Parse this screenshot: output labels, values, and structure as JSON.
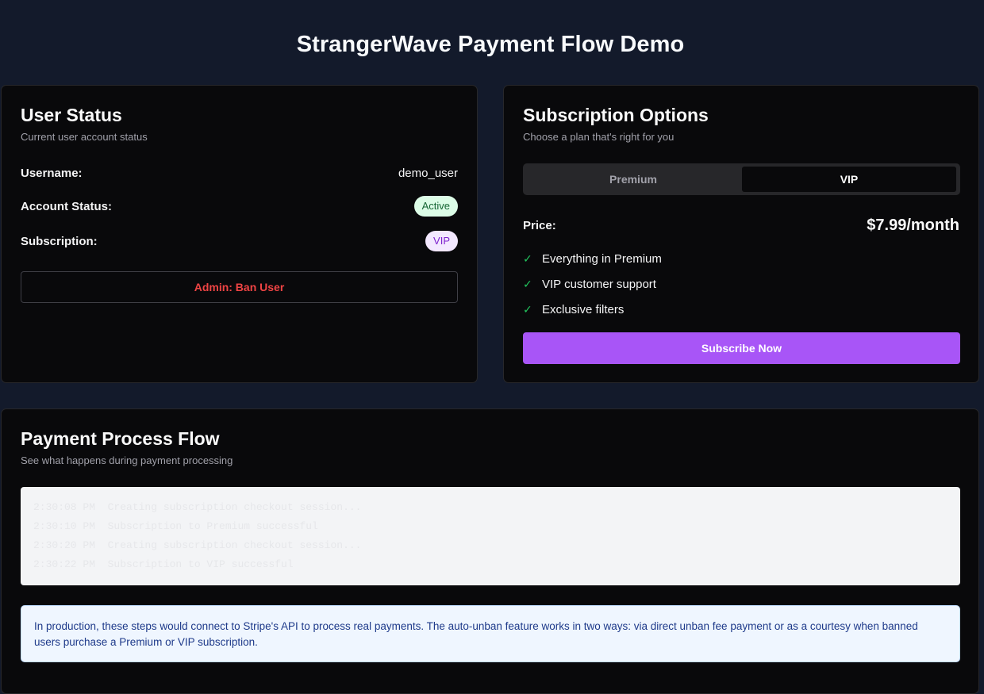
{
  "page": {
    "title": "StrangerWave Payment Flow Demo"
  },
  "user_status": {
    "title": "User Status",
    "subtitle": "Current user account status",
    "rows": [
      {
        "label": "Username:",
        "value": "demo_user"
      },
      {
        "label": "Account Status:",
        "value": "Active"
      },
      {
        "label": "Subscription:",
        "value": "VIP"
      }
    ],
    "ban_button": "Admin: Ban User"
  },
  "subscription": {
    "title": "Subscription Options",
    "subtitle": "Choose a plan that's right for you",
    "tabs": [
      {
        "label": "Premium",
        "selected": false
      },
      {
        "label": "VIP",
        "selected": true
      }
    ],
    "price_label": "Price:",
    "price_value": "$7.99/month",
    "features": [
      "Everything in Premium",
      "VIP customer support",
      "Exclusive filters"
    ],
    "subscribe_button": "Subscribe Now"
  },
  "payment_flow": {
    "title": "Payment Process Flow",
    "subtitle": "See what happens during payment processing",
    "log": [
      "2:30:08 PM  Creating subscription checkout session...",
      "2:30:10 PM  Subscription to Premium successful",
      "2:30:20 PM  Creating subscription checkout session...",
      "2:30:22 PM  Subscription to VIP successful"
    ],
    "info": "In production, these steps would connect to Stripe's API to process real payments. The auto-unban feature works in two ways: via direct unban fee payment or as a courtesy when banned users purchase a Premium or VIP subscription."
  },
  "colors": {
    "background": "#131a2b",
    "card": "#09090b",
    "accent": "#a855f7",
    "danger": "#ef4444",
    "success": "#22c55e"
  },
  "icons": {
    "feature_check": "check-icon"
  }
}
